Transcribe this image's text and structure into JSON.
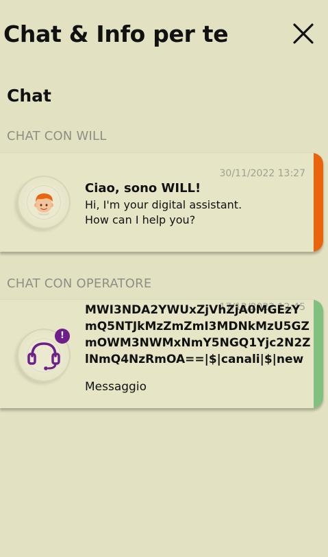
{
  "header": {
    "title": "Chat & Info per te",
    "close_icon": "close-icon"
  },
  "section": {
    "title": "Chat"
  },
  "will_group": {
    "label": "CHAT CON WILL",
    "card": {
      "timestamp": "30/11/2022 13:27",
      "title": "Ciao, sono WILL!",
      "line1": "Hi, I'm your digital assistant.",
      "line2": "How can I help you?",
      "avatar_icon": "will-avatar-icon",
      "accent_color": "#e8650e"
    }
  },
  "operator_group": {
    "label": "CHAT CON OPERATORE",
    "card": {
      "timestamp": "17/12/2022 12:45",
      "title": "MWI3NDA2YWUxZjVhZjA0MGEzYmQ5NTJkMzZmZmI3MDNkMzU5GZmOWM3NWMxNmY5NGQ1Yjc2N2ZlNmQ4NzRmOA==|$|canali|$|new",
      "subtitle": "Messaggio",
      "badge": "!",
      "avatar_icon": "headset-icon",
      "accent_color": "#82c080"
    }
  },
  "colors": {
    "background": "#e2e1c2",
    "brand_purple": "#6d2089"
  }
}
